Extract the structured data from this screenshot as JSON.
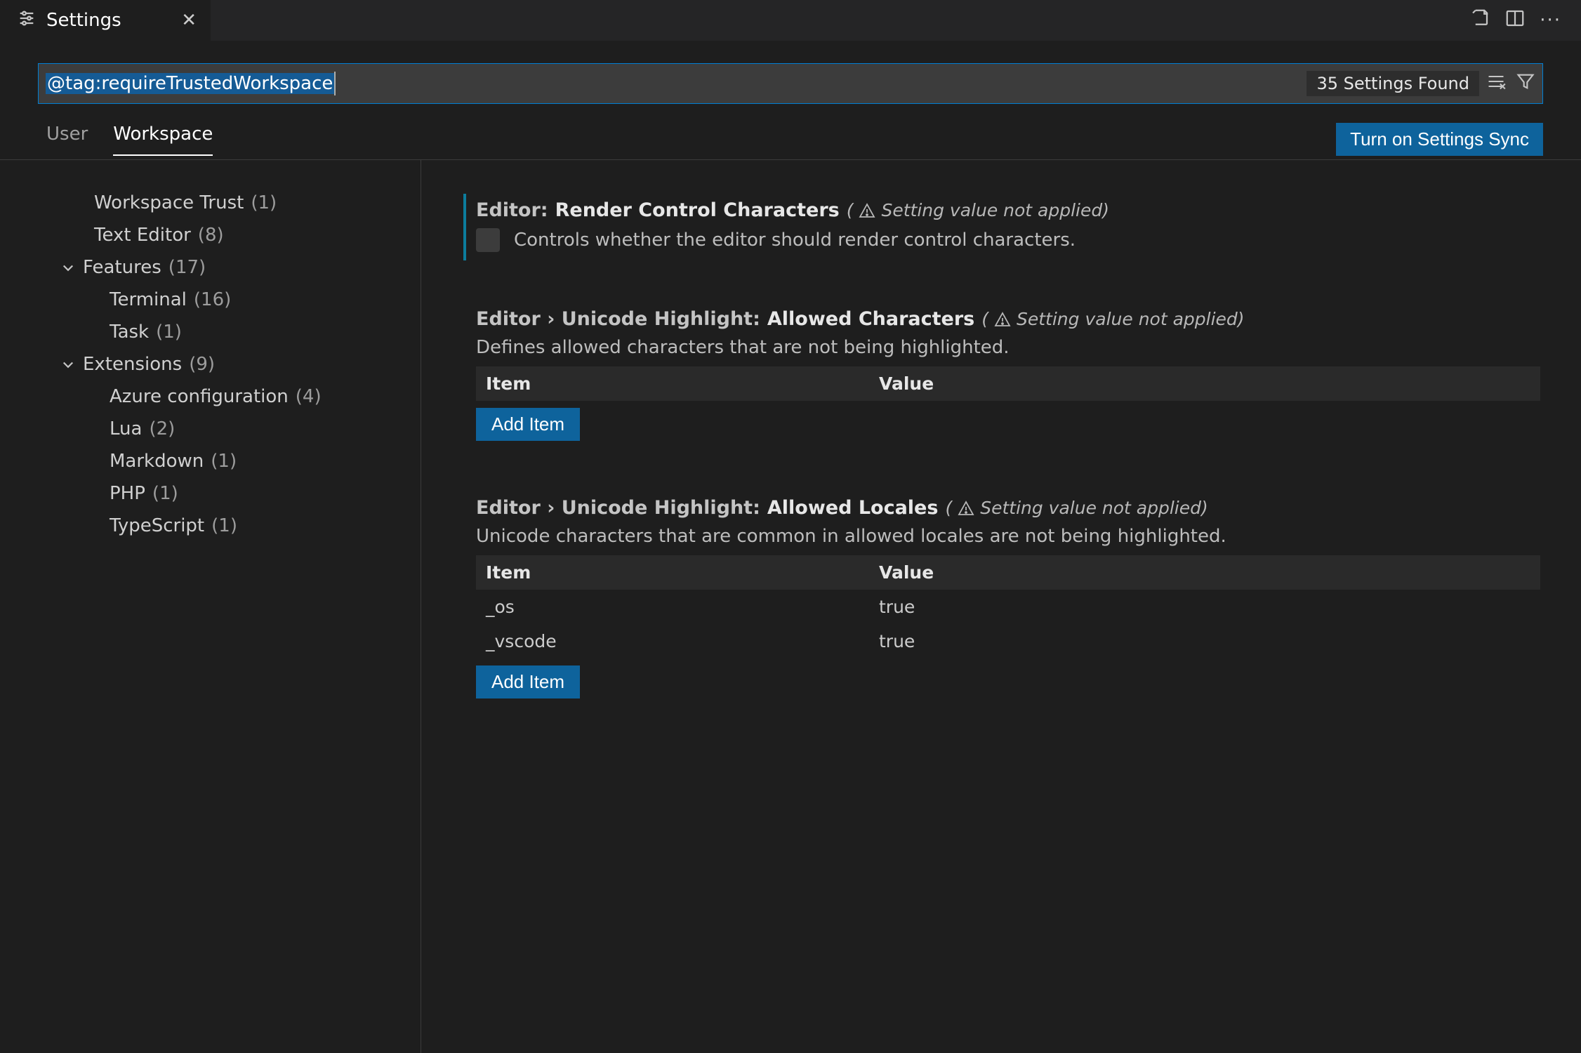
{
  "tab": {
    "title": "Settings"
  },
  "search": {
    "query": "@tag:requireTrustedWorkspace",
    "results_label": "35 Settings Found"
  },
  "scope": {
    "user": "User",
    "workspace": "Workspace",
    "sync_button": "Turn on Settings Sync"
  },
  "toc": {
    "workspace_trust": {
      "label": "Workspace Trust",
      "count": "(1)"
    },
    "text_editor": {
      "label": "Text Editor",
      "count": "(8)"
    },
    "features": {
      "label": "Features",
      "count": "(17)"
    },
    "terminal": {
      "label": "Terminal",
      "count": "(16)"
    },
    "task": {
      "label": "Task",
      "count": "(1)"
    },
    "extensions": {
      "label": "Extensions",
      "count": "(9)"
    },
    "azure": {
      "label": "Azure configuration",
      "count": "(4)"
    },
    "lua": {
      "label": "Lua",
      "count": "(2)"
    },
    "markdown": {
      "label": "Markdown",
      "count": "(1)"
    },
    "php": {
      "label": "PHP",
      "count": "(1)"
    },
    "typescript": {
      "label": "TypeScript",
      "count": "(1)"
    }
  },
  "labels": {
    "warn": "Setting value not applied)",
    "item": "Item",
    "value": "Value",
    "add_item": "Add Item"
  },
  "settings": {
    "rcc": {
      "prefix": "Editor:",
      "name": "Render Control Characters",
      "desc": "Controls whether the editor should render control characters."
    },
    "uhc": {
      "prefix": "Editor › Unicode Highlight:",
      "name": "Allowed Characters",
      "desc": "Defines allowed characters that are not being highlighted."
    },
    "uhl": {
      "prefix": "Editor › Unicode Highlight:",
      "name": "Allowed Locales",
      "desc": "Unicode characters that are common in allowed locales are not being highlighted.",
      "rows": [
        {
          "k": "_os",
          "v": "true"
        },
        {
          "k": "_vscode",
          "v": "true"
        }
      ]
    }
  }
}
